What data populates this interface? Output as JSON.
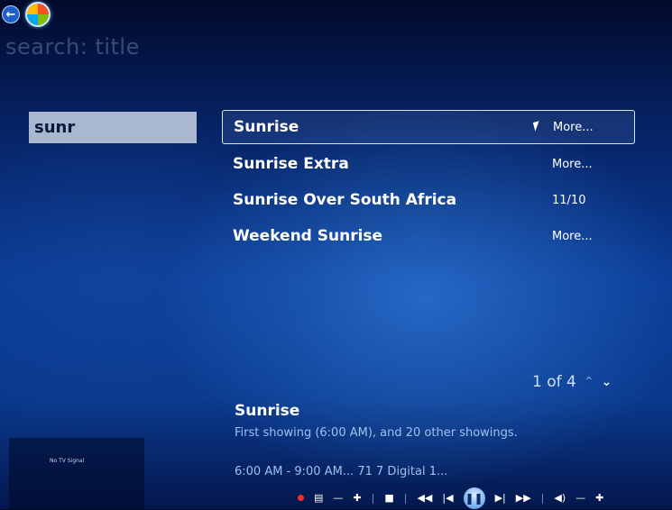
{
  "page_title": "search: title",
  "search": {
    "query": "sunr"
  },
  "results": [
    {
      "title": "Sunrise",
      "meta": "More...",
      "focused": true
    },
    {
      "title": "Sunrise Extra",
      "meta": "More..."
    },
    {
      "title": "Sunrise Over South Africa",
      "meta": "11/10"
    },
    {
      "title": "Weekend Sunrise",
      "meta": "More..."
    }
  ],
  "pager": {
    "text": "1 of 4"
  },
  "details": {
    "title": "Sunrise",
    "subtitle": "First showing (6:00 AM), and 20 other showings.",
    "time_channel": "6:00 AM - 9:00 AM...   71 7 Digital 1..."
  },
  "preview": {
    "text": "No TV Signal"
  },
  "icons": {
    "back": "back-arrow-icon",
    "start": "windows-orb-icon",
    "record": "record-icon",
    "guide": "guide-icon",
    "channel_down": "minus-icon",
    "channel_up": "plus-icon",
    "stop": "stop-icon",
    "rewind": "rewind-icon",
    "skip_back": "skip-back-icon",
    "pause": "pause-icon",
    "skip_forward": "skip-forward-icon",
    "fast_forward": "fast-forward-icon",
    "mute": "mute-icon",
    "volume_down": "minus-icon",
    "volume_up": "plus-icon"
  },
  "colors": {
    "accent": "#0a3c96",
    "search_box": "#a9b7d1",
    "record": "#ff2a2a"
  }
}
